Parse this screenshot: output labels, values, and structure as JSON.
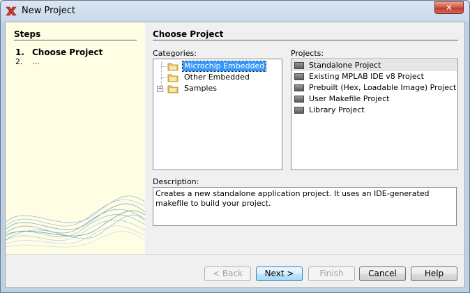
{
  "window": {
    "title": "New Project",
    "close_label": "✕"
  },
  "steps": {
    "title": "Steps",
    "items": [
      {
        "num": "1.",
        "label": "Choose Project"
      },
      {
        "num": "2.",
        "label": "..."
      }
    ]
  },
  "main": {
    "title": "Choose Project",
    "categories_label": "Categories:",
    "categories": [
      {
        "label": "Microchip Embedded",
        "selected": true
      },
      {
        "label": "Other Embedded",
        "selected": false
      },
      {
        "label": "Samples",
        "expandable": true,
        "selected": false
      }
    ],
    "projects_label": "Projects:",
    "projects": [
      {
        "label": "Standalone Project",
        "selected": true
      },
      {
        "label": "Existing MPLAB IDE v8 Project"
      },
      {
        "label": "Prebuilt (Hex, Loadable Image) Project"
      },
      {
        "label": "User Makefile Project"
      },
      {
        "label": "Library Project"
      }
    ],
    "description_label": "Description:",
    "description": "Creates a new standalone application project. It uses an IDE-generated makefile to build your project."
  },
  "buttons": {
    "back": "< Back",
    "next": "Next >",
    "finish": "Finish",
    "cancel": "Cancel",
    "help": "Help"
  }
}
